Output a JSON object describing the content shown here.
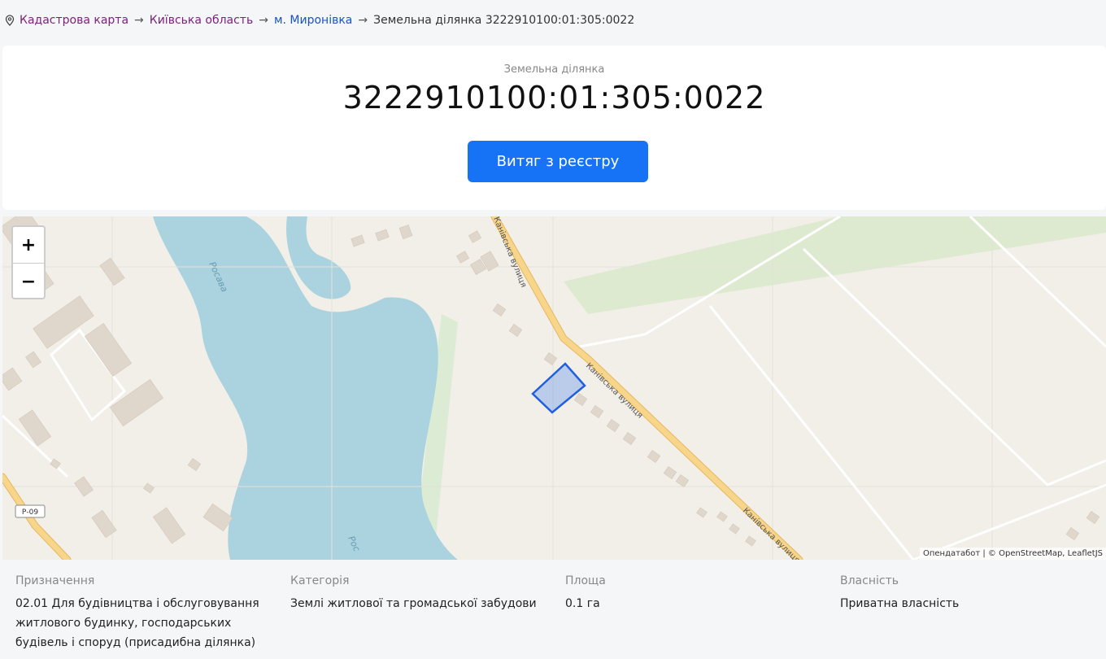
{
  "breadcrumb": {
    "items": [
      {
        "label": "Кадастрова карта",
        "style": "visited"
      },
      {
        "label": "Київська область",
        "style": "visited"
      },
      {
        "label": "м. Миронівка",
        "style": "link"
      },
      {
        "label": "Земельна ділянка 3222910100:01:305:0022",
        "style": "plain"
      }
    ],
    "separator": "→"
  },
  "header": {
    "subtitle": "Земельна ділянка",
    "title": "3222910100:01:305:0022",
    "button_label": "Витяг з реєстру"
  },
  "map": {
    "zoom_in": "+",
    "zoom_out": "−",
    "labels": {
      "lake1": "Росава",
      "lake2": "Рос",
      "street_top": "Канівська вулиця",
      "street_mid": "Канівська вулиця",
      "street_bottom": "Канівська вулиця",
      "road_badge": "Р-09"
    },
    "attribution": "Опендатабот | © OpenStreetMap, LeafletJS",
    "colors": {
      "water": "#aad3df",
      "road": "#f7d58b",
      "parcel": "#1f5fe0"
    }
  },
  "info": {
    "purpose": {
      "label": "Призначення",
      "lines": [
        "02.01 Для будівництва і обслуговування",
        "житлового будинку, господарських",
        "будівель і споруд (присадибна ділянка)"
      ]
    },
    "category": {
      "label": "Категорія",
      "value": "Землі житлової та громадської забудови"
    },
    "area": {
      "label": "Площа",
      "value": "0.1 га"
    },
    "ownership": {
      "label": "Власність",
      "value": "Приватна власність"
    }
  }
}
